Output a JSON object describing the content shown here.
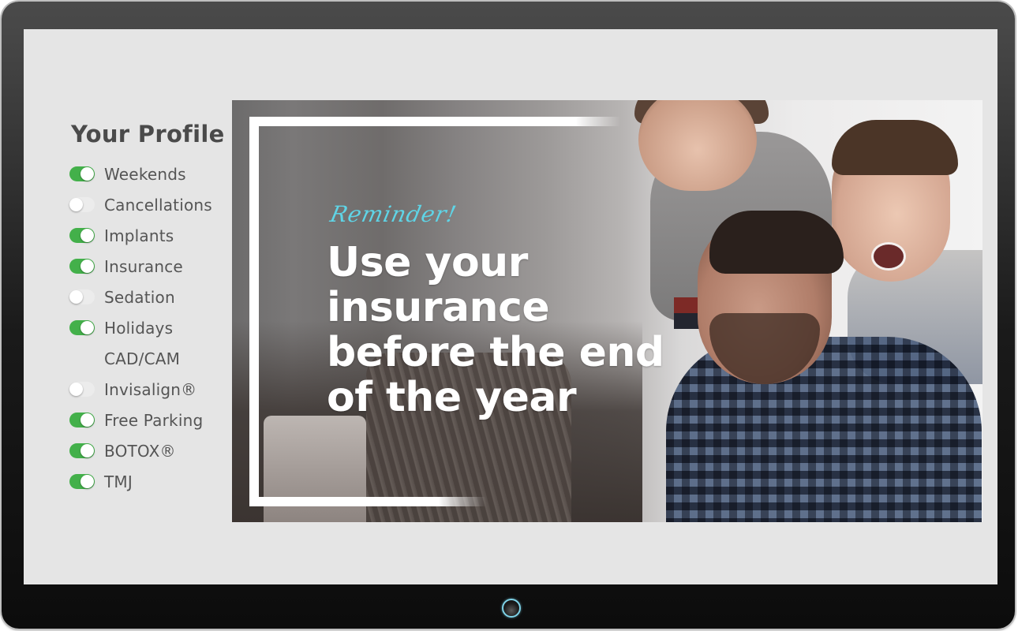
{
  "profile": {
    "title": "Your Profile",
    "items": [
      {
        "label": "Weekends",
        "state": "on"
      },
      {
        "label": "Cancellations",
        "state": "off"
      },
      {
        "label": "Implants",
        "state": "on"
      },
      {
        "label": "Insurance",
        "state": "on"
      },
      {
        "label": "Sedation",
        "state": "off"
      },
      {
        "label": "Holidays",
        "state": "on"
      },
      {
        "label": "CAD/CAM",
        "state": "none"
      },
      {
        "label": "Invisalign®",
        "state": "off"
      },
      {
        "label": "Free Parking",
        "state": "on"
      },
      {
        "label": "BOTOX®",
        "state": "on"
      },
      {
        "label": "TMJ",
        "state": "on"
      }
    ]
  },
  "banner": {
    "reminder": "Reminder!",
    "headline_lines": [
      "Use your",
      "insurance",
      "before the end",
      "of the year"
    ],
    "photo_description": "father carrying two laughing boys"
  },
  "colors": {
    "toggle_on": "#43b04a",
    "toggle_off": "#ececec",
    "reminder_accent": "#5fd4e6",
    "home_button_ring": "#7fd3e8"
  }
}
